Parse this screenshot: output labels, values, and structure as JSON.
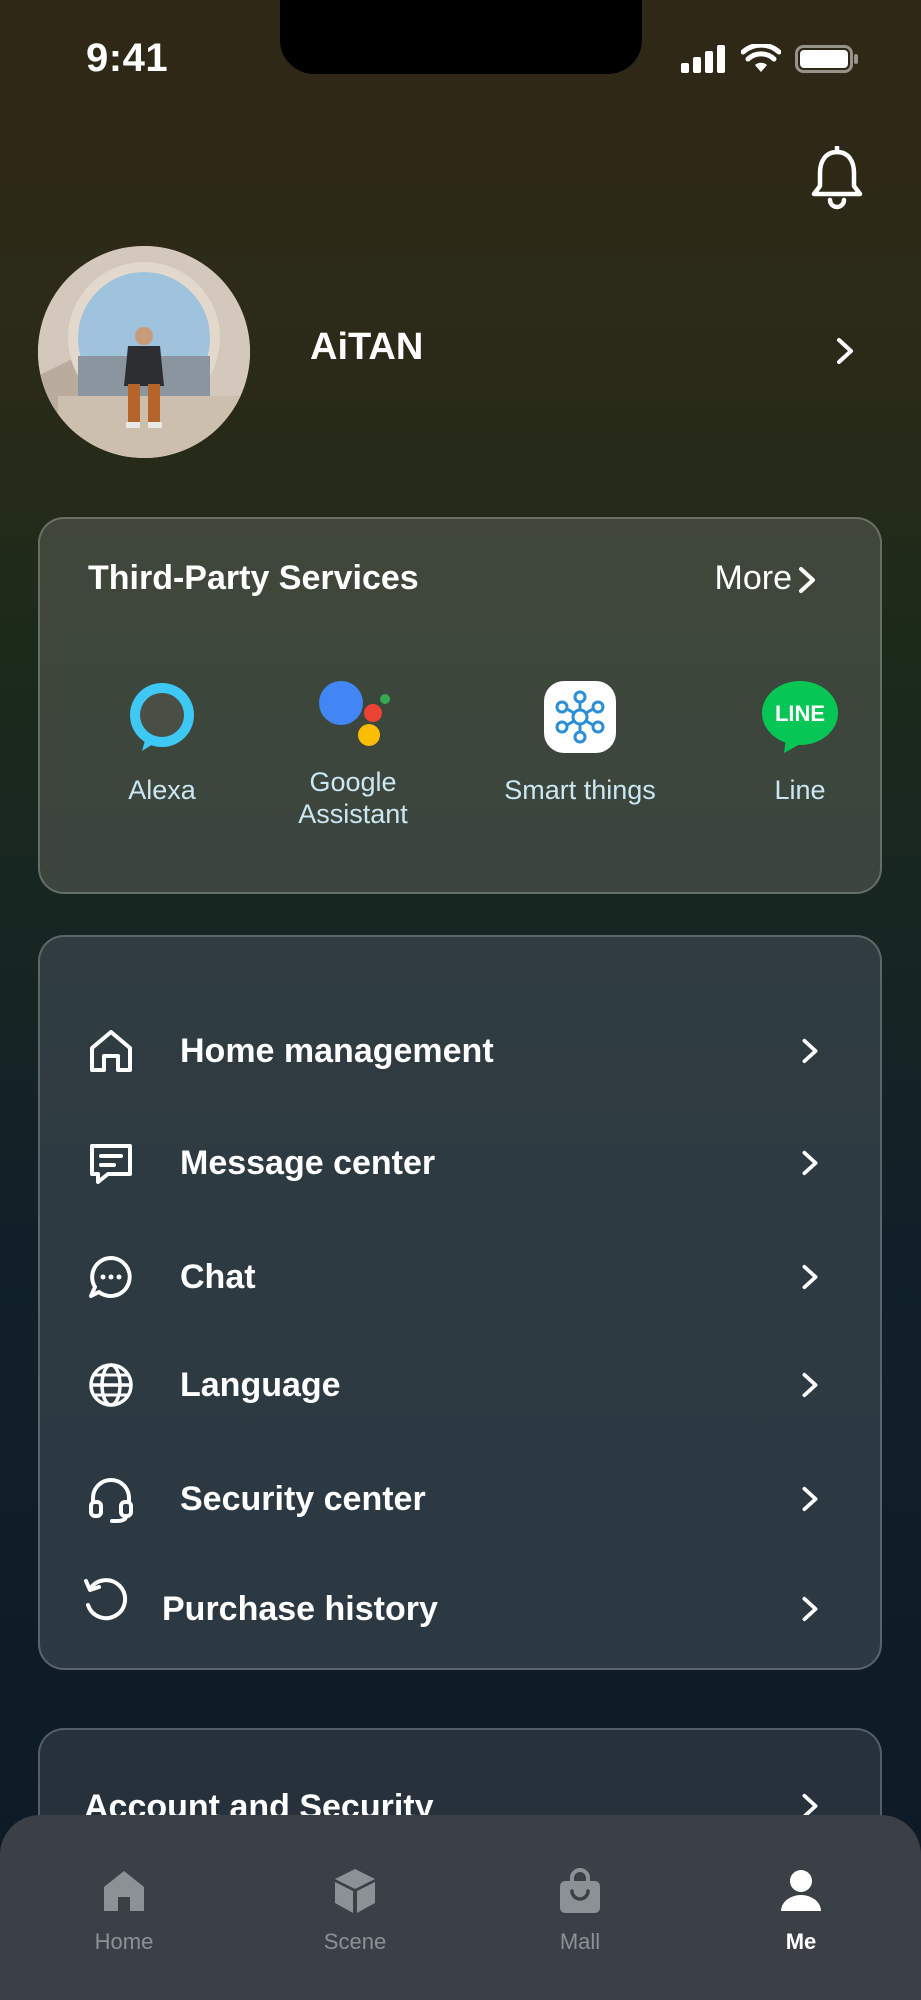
{
  "status_bar": {
    "time": "9:41"
  },
  "profile": {
    "name": "AiTAN"
  },
  "third_party": {
    "title": "Third-Party Services",
    "more_label": "More",
    "services": [
      {
        "label": "Alexa",
        "icon": "alexa-icon"
      },
      {
        "label": "Google\nAssistant",
        "icon": "google-assistant-icon"
      },
      {
        "label": "Smart things",
        "icon": "smartthings-icon"
      },
      {
        "label": "Line",
        "icon": "line-icon",
        "logo_text": "LINE"
      }
    ]
  },
  "menu": {
    "items": [
      {
        "label": "Home management",
        "icon": "home-outline-icon"
      },
      {
        "label": "Message center",
        "icon": "message-icon"
      },
      {
        "label": "Chat",
        "icon": "chat-icon"
      },
      {
        "label": "Language",
        "icon": "globe-icon"
      },
      {
        "label": "Security center",
        "icon": "headset-icon"
      },
      {
        "label": "Purchase history",
        "icon": "history-icon"
      }
    ]
  },
  "account": {
    "label": "Account and Security"
  },
  "tabbar": {
    "tabs": [
      {
        "label": "Home",
        "icon": "home-icon",
        "active": false
      },
      {
        "label": "Scene",
        "icon": "cube-icon",
        "active": false
      },
      {
        "label": "Mall",
        "icon": "bag-icon",
        "active": false
      },
      {
        "label": "Me",
        "icon": "person-icon",
        "active": true
      }
    ]
  },
  "colors": {
    "accent_text": "#cbe7f2",
    "alexa": "#3ec8f4",
    "line_green": "#06c755",
    "tab_inactive": "#8c9196"
  }
}
